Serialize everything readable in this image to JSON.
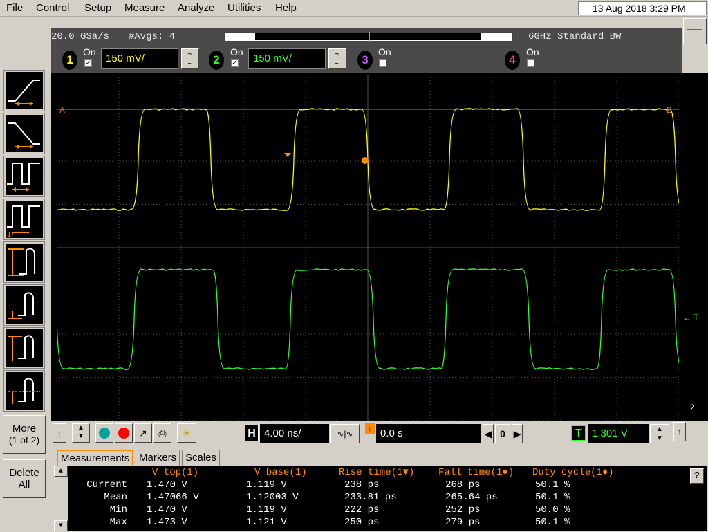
{
  "menu": [
    "File",
    "Control",
    "Setup",
    "Measure",
    "Analyze",
    "Utilities",
    "Help"
  ],
  "datetime": "13 Aug 2018  3:29 PM",
  "status": {
    "sample_rate": "20.0 GSa/s",
    "averages": "#Avgs: 4",
    "bandwidth": "6GHz Standard BW"
  },
  "channels": [
    {
      "num": "1",
      "on_label": "On",
      "checked": true,
      "scale": "150 mV/",
      "color": "#ffff00"
    },
    {
      "num": "2",
      "on_label": "On",
      "checked": true,
      "scale": "150 mV/",
      "color": "#33ff33"
    },
    {
      "num": "3",
      "on_label": "On",
      "checked": false,
      "color": "#cc55ff"
    },
    {
      "num": "4",
      "on_label": "On",
      "checked": false,
      "color": "#ff3366"
    }
  ],
  "left_toolbar": {
    "more_label": "More",
    "more_page": "(1 of 2)",
    "delete_label": "Delete",
    "delete_label2": "All"
  },
  "markers": {
    "a": "A",
    "b": "B",
    "trigger_mark": "T",
    "ground_mark": "2"
  },
  "timebase": {
    "h_label": "H",
    "scale": "4.00 ns/",
    "position": "0.0 s",
    "zero": "0"
  },
  "trigger": {
    "t_label": "T",
    "level": "1.301 V"
  },
  "tabs": [
    "Measurements",
    "Markers",
    "Scales"
  ],
  "measurements": {
    "headers": [
      "V top(1)",
      "V base(1)",
      "Rise time(1▼)",
      "Fall time(1●)",
      "Duty cycle(1♦)"
    ],
    "rows": [
      {
        "label": "Current",
        "values": [
          "1.470 V",
          "1.119 V",
          "238 ps",
          "268 ps",
          "50.1 %"
        ]
      },
      {
        "label": "Mean",
        "values": [
          "1.47066 V",
          "1.12003 V",
          "233.81 ps",
          "265.64 ps",
          "50.1 %"
        ]
      },
      {
        "label": "Min",
        "values": [
          "1.470 V",
          "1.119 V",
          "222 ps",
          "252 ps",
          "50.0 %"
        ]
      },
      {
        "label": "Max",
        "values": [
          "1.473 V",
          "1.121 V",
          "250 ps",
          "279 ps",
          "50.1 %"
        ]
      }
    ]
  },
  "colors": {
    "ch1": "#ffff00",
    "ch2": "#33ff33",
    "accent": "#ff8c00"
  }
}
